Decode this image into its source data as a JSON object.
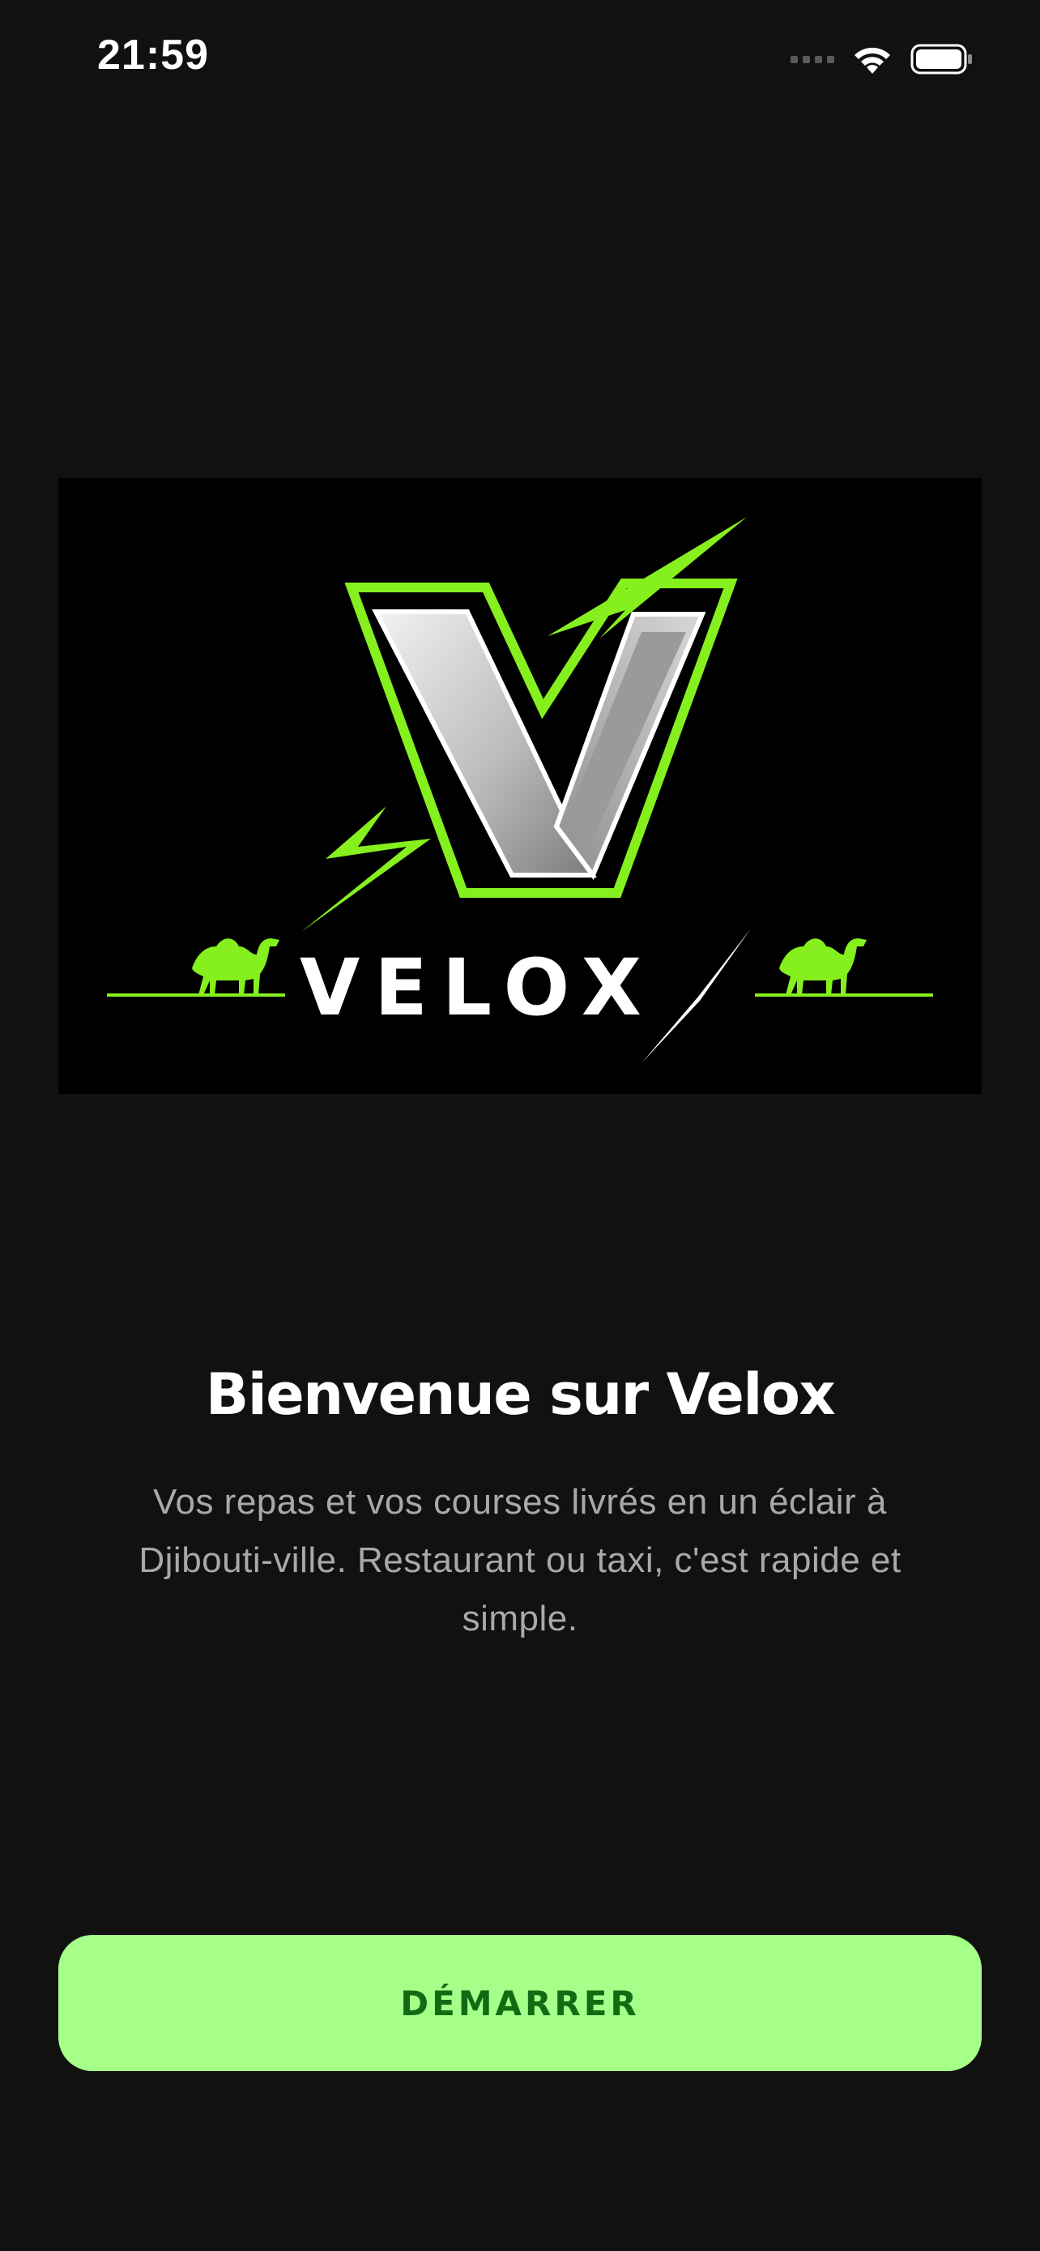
{
  "status_bar": {
    "time": "21:59",
    "icons": [
      "signal-dots-icon",
      "wifi-icon",
      "battery-icon"
    ]
  },
  "logo": {
    "wordmark": "VELOX",
    "icons": [
      "velox-v-logo-icon",
      "camel-icon"
    ]
  },
  "welcome": {
    "title": "Bienvenue sur Velox",
    "description": "Vos repas et vos courses livrés en un éclair à Djibouti-ville. Restaurant ou taxi, c'est rapide et simple."
  },
  "actions": {
    "start_label": "DÉMARRER"
  },
  "colors": {
    "background": "#111111",
    "logo_background": "#000000",
    "accent_green": "#86f01e",
    "button_background": "#a5ff88",
    "button_text": "#126b13",
    "description_text": "#a9a9a9"
  }
}
